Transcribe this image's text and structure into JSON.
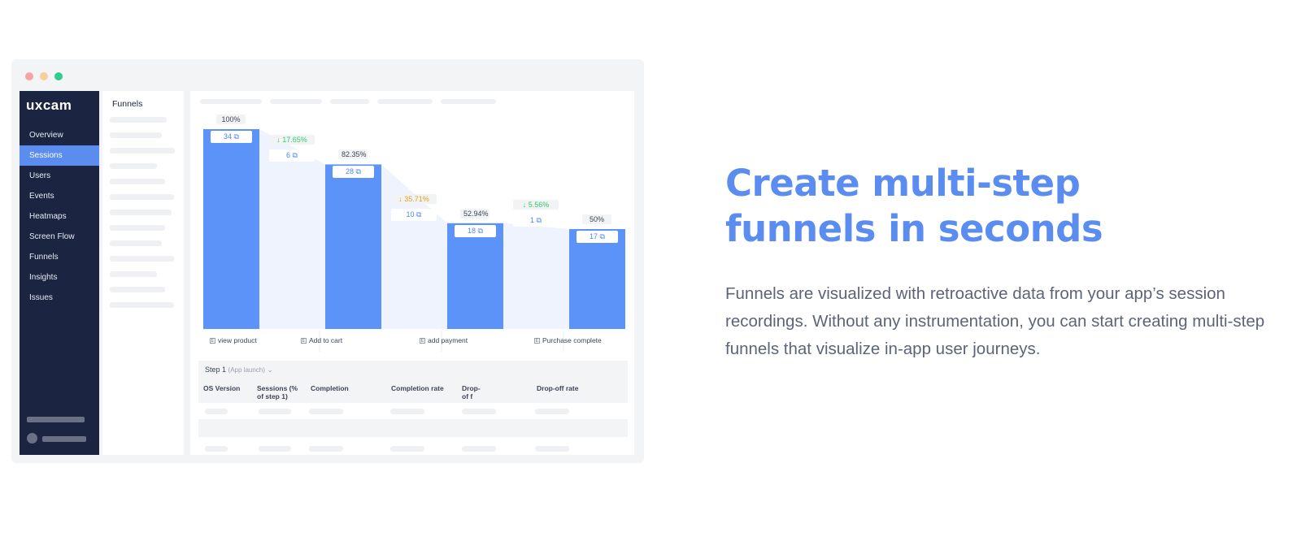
{
  "window_dots": [
    "close",
    "minimize",
    "maximize"
  ],
  "logo": "uxcam",
  "sidebar": {
    "items": [
      {
        "label": "Overview",
        "active": false
      },
      {
        "label": "Sessions",
        "active": true
      },
      {
        "label": "Users",
        "active": false
      },
      {
        "label": "Events",
        "active": false
      },
      {
        "label": "Heatmaps",
        "active": false
      },
      {
        "label": "Screen Flow",
        "active": false
      },
      {
        "label": "Funnels",
        "active": false
      },
      {
        "label": "Insights",
        "active": false
      },
      {
        "label": "Issues",
        "active": false
      }
    ]
  },
  "list_panel": {
    "title": "Funnels"
  },
  "chart_data": {
    "type": "bar",
    "categories": [
      "view product",
      "Add to cart",
      "add payment",
      "Purchase complete"
    ],
    "values": [
      34,
      28,
      18,
      17
    ],
    "percent_labels": [
      "100%",
      "82.35%",
      "52.94%",
      "50%"
    ],
    "dropoffs": [
      {
        "percent": "17.65%",
        "count": "6",
        "color": "#2ecc71"
      },
      {
        "percent": "35.71%",
        "count": "10",
        "color": "#e0a21a"
      },
      {
        "percent": "5.56%",
        "count": "1",
        "color": "#2ecc71"
      }
    ],
    "ylim": [
      0,
      34
    ],
    "bar_color": "#5b93f8",
    "dropoff_fill": "#eef3fd"
  },
  "table": {
    "step_label": "Step 1",
    "step_sub": "(App launch)",
    "columns": [
      "OS Version",
      "Sessions (% of step 1)",
      "Completion",
      "Completion rate",
      "Drop-of f",
      "Drop-off rate"
    ]
  },
  "hero": {
    "headline_line1": "Create multi-step",
    "headline_line2": "funnels in seconds",
    "description": "Funnels are visualized with retroactive data from your app’s session recordings. Without any instrumentation, you can start creating multi-step funnels that visualize in-app user journeys."
  },
  "colors": {
    "accent": "#5b8df0",
    "sidebar_bg": "#1b2440",
    "text_gray": "#5d6477"
  }
}
